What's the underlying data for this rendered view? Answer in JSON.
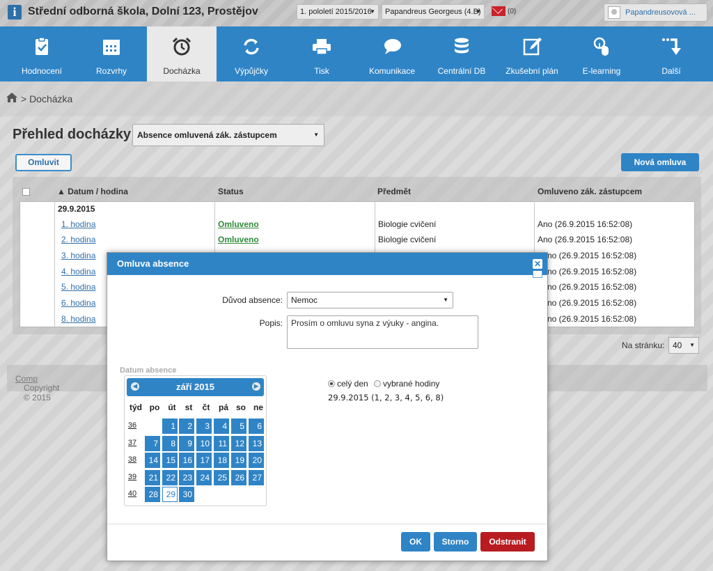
{
  "header": {
    "school": "Střední odborná škola, Dolní 123, Prostějov",
    "period": "1. pololetí 2015/2016",
    "student": "Papandreus Georgeus (4.B)",
    "messages": "(0)",
    "user": "Papandreusovová ..."
  },
  "nav": [
    {
      "label": "Hodnocení",
      "icon": "clipboard-check-icon"
    },
    {
      "label": "Rozvrhy",
      "icon": "calendar-grid-icon"
    },
    {
      "label": "Docházka",
      "icon": "alarm-clock-icon"
    },
    {
      "label": "Výpůjčky",
      "icon": "refresh-arrows-icon"
    },
    {
      "label": "Tisk",
      "icon": "printer-icon"
    },
    {
      "label": "Komunikace",
      "icon": "chat-bubbles-icon"
    },
    {
      "label": "Centrální DB",
      "icon": "database-icon"
    },
    {
      "label": "Zkušební plán",
      "icon": "edit-pencil-icon"
    },
    {
      "label": "E-learning",
      "icon": "mouse-learning-icon"
    },
    {
      "label": "Další",
      "icon": "more-arrow-icon"
    }
  ],
  "breadcrumb": "> Docházka",
  "page": {
    "title": "Přehled docházky",
    "filter": "Absence omluvená zák. zástupcem",
    "excuse_btn": "Omluvit",
    "new_btn": "Nová omluva"
  },
  "table": {
    "headers": [
      "▲ Datum / hodina",
      "Status",
      "Předmět",
      "Omluveno zák. zástupcem"
    ],
    "date": "29.9.2015",
    "rows": [
      {
        "hour": "1. hodina",
        "status": "Omluveno",
        "subject": "Biologie cvičení",
        "excused": "Ano (26.9.2015 16:52:08)"
      },
      {
        "hour": "2. hodina",
        "status": "Omluveno",
        "subject": "Biologie cvičení",
        "excused": "Ano (26.9.2015 16:52:08)"
      },
      {
        "hour": "3. hodina",
        "status": "",
        "subject": "",
        "excused": "no (26.9.2015 16:52:08)"
      },
      {
        "hour": "4. hodina",
        "status": "",
        "subject": "",
        "excused": "no (26.9.2015 16:52:08)"
      },
      {
        "hour": "5. hodina",
        "status": "",
        "subject": "",
        "excused": "no (26.9.2015 16:52:08)"
      },
      {
        "hour": "6. hodina",
        "status": "",
        "subject": "",
        "excused": "no (26.9.2015 16:52:08)"
      },
      {
        "hour": "8. hodina",
        "status": "",
        "subject": "",
        "excused": "no (26.9.2015 16:52:08)"
      }
    ]
  },
  "pager": {
    "label": "Na stránku:",
    "value": "40"
  },
  "footer": {
    "copyright": "Copyright © 2015",
    "link": "Comp"
  },
  "modal": {
    "title": "Omluva absence",
    "reason_label": "Důvod absence:",
    "reason_value": "Nemoc",
    "desc_label": "Popis:",
    "desc_value": "Prosím o omluvu syna z výuky - angina.",
    "date_label": "Datum absence",
    "calendar": {
      "month": "září 2015",
      "dow": [
        "týd",
        "po",
        "út",
        "st",
        "čt",
        "pá",
        "so",
        "ne"
      ],
      "weeks": [
        {
          "no": "36",
          "days": [
            "",
            "1",
            "2",
            "3",
            "4",
            "5",
            "6"
          ]
        },
        {
          "no": "37",
          "days": [
            "7",
            "8",
            "9",
            "10",
            "11",
            "12",
            "13"
          ]
        },
        {
          "no": "38",
          "days": [
            "14",
            "15",
            "16",
            "17",
            "18",
            "19",
            "20"
          ]
        },
        {
          "no": "39",
          "days": [
            "21",
            "22",
            "23",
            "24",
            "25",
            "26",
            "27"
          ]
        },
        {
          "no": "40",
          "days": [
            "28",
            "29",
            "30",
            "",
            "",
            "",
            ""
          ]
        }
      ],
      "today": "29"
    },
    "radio_full": "celý den",
    "radio_hours": "vybrané hodiny",
    "summary": "29.9.2015 (1, 2, 3, 4, 5, 6, 8)",
    "ok": "OK",
    "cancel": "Storno",
    "delete": "Odstranit"
  },
  "colors": {
    "accent": "#2f84c6",
    "danger": "#b81c21",
    "status_ok": "#2e8b3a"
  }
}
